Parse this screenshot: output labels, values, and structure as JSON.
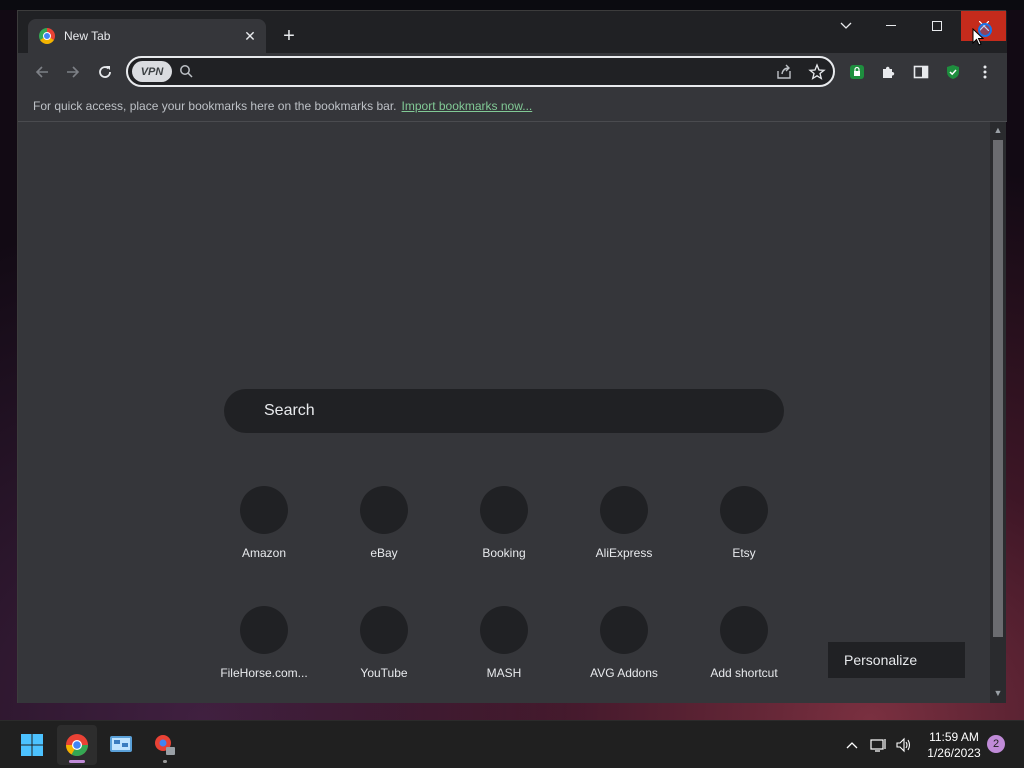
{
  "browser": {
    "tab": {
      "title": "New Tab",
      "close_label": "✕"
    },
    "new_tab_label": "+"
  },
  "omnibox": {
    "vpn_label": "VPN",
    "value": ""
  },
  "bookmarks_bar": {
    "hint": "For quick access, place your bookmarks here on the bookmarks bar.",
    "import_link": "Import bookmarks now..."
  },
  "ntp": {
    "search_placeholder": "Search",
    "shortcuts": [
      {
        "label": "Amazon"
      },
      {
        "label": "eBay"
      },
      {
        "label": "Booking"
      },
      {
        "label": "AliExpress"
      },
      {
        "label": "Etsy"
      },
      {
        "label": "FileHorse.com..."
      },
      {
        "label": "YouTube"
      },
      {
        "label": "MASH"
      },
      {
        "label": "AVG Addons"
      },
      {
        "label": "Add shortcut"
      }
    ],
    "personalize_label": "Personalize"
  },
  "taskbar": {
    "clock": {
      "time": "11:59 AM",
      "date": "1/26/2023"
    },
    "notification_count": "2"
  },
  "colors": {
    "close_button": "#c42b1c",
    "accent_link": "#81c995",
    "taskbar_accent": "#c08bd8"
  }
}
